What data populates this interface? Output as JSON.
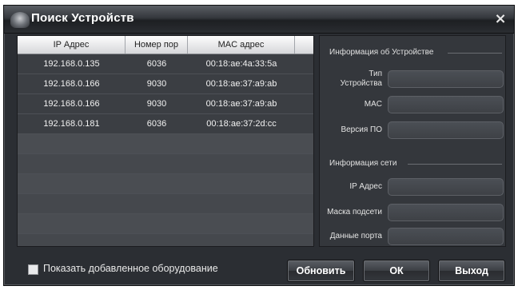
{
  "window": {
    "title": "Поиск Устройств",
    "close_glyph": "×"
  },
  "table": {
    "headers": [
      "IP Адрес",
      "Номер пор",
      "MAC адрес"
    ],
    "rows": [
      [
        "192.168.0.135",
        "6036",
        "00:18:ae:4a:33:5a"
      ],
      [
        "192.168.0.166",
        "9030",
        "00:18:ae:37:a9:ab"
      ],
      [
        "192.168.0.166",
        "9030",
        "00:18:ae:37:a9:ab"
      ],
      [
        "192.168.0.181",
        "6036",
        "00:18:ae:37:2d:cc"
      ]
    ]
  },
  "device_info": {
    "section_title": "Информация об Устройстве",
    "type_label_1": "Тип",
    "type_label_2": "Устройства",
    "mac_label": "MAC",
    "firmware_label": "Версия ПО",
    "type_value": "",
    "mac_value": "",
    "firmware_value": ""
  },
  "network_info": {
    "section_title": "Информация сети",
    "ip_label": "IP Адрес",
    "mask_label": "Маска подсети",
    "port_label": "Данные порта",
    "ip_value": "",
    "mask_value": "",
    "port_value": ""
  },
  "footer": {
    "show_added_label": "Показать добавленное оборудование",
    "show_added_checked": false,
    "refresh_label": "Обновить",
    "ok_label": "ОК",
    "exit_label": "Выход"
  }
}
